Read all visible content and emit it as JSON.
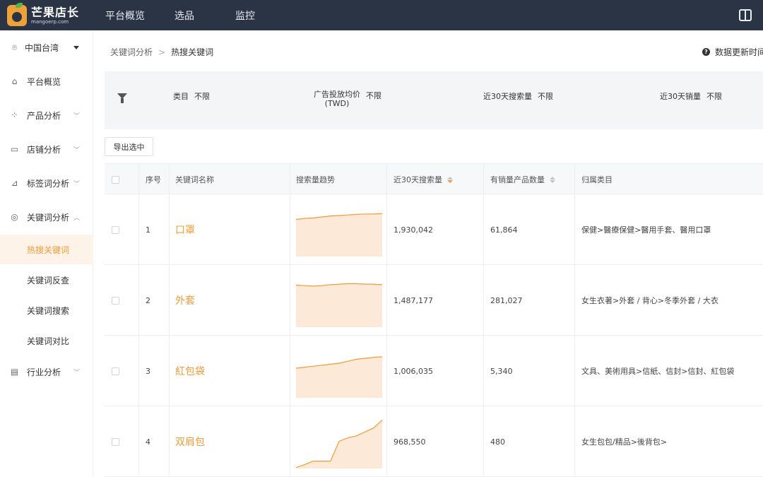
{
  "logo": {
    "title": "芒果店长",
    "subtitle": "mangoerp.com"
  },
  "topnav": [
    "平台概览",
    "选品",
    "监控"
  ],
  "icons": {
    "book": "book-icon",
    "location": "location-pin-icon",
    "filter": "filter-funnel-icon",
    "help": "question-circle-icon"
  },
  "colors": {
    "topbar": "#2b3445",
    "accent": "#f29b38",
    "spark_fill": "#fde9d7"
  },
  "sidebar": {
    "region": "中国台湾",
    "items": [
      {
        "label": "平台概览",
        "icon": "home-icon"
      },
      {
        "label": "产品分析",
        "icon": "grid-icon"
      },
      {
        "label": "店铺分析",
        "icon": "store-icon"
      },
      {
        "label": "标签词分析",
        "icon": "chart-icon"
      },
      {
        "label": "关键词分析",
        "icon": "target-icon"
      },
      {
        "label": "行业分析",
        "icon": "report-icon"
      }
    ],
    "sub_items": [
      "热搜关键词",
      "关键词反查",
      "关键词搜索",
      "关键词对比"
    ]
  },
  "breadcrumb": {
    "parent": "关键词分析",
    "separator": ">",
    "current": "热搜关键词"
  },
  "update_text": "数据更新时间",
  "filters": [
    {
      "name": "类目",
      "value": "不限"
    },
    {
      "name": "广告投放均价",
      "unit": "(TWD)",
      "value": "不限"
    },
    {
      "name": "近30天搜索量",
      "value": "不限"
    },
    {
      "name": "近30天销量",
      "value": "不限"
    }
  ],
  "export_label": "导出选中",
  "table": {
    "headers": [
      "序号",
      "关键词名称",
      "搜索量趋势",
      "近30天搜索量",
      "有销量产品数量",
      "归属类目"
    ],
    "rows": [
      {
        "index": "1",
        "keyword": "口罩",
        "searches": "1,930,042",
        "products": "61,864",
        "category": "保健>醫療保健>醫用手套、醫用口罩",
        "trend": [
          0.75,
          0.77,
          0.78,
          0.8,
          0.82,
          0.83,
          0.84,
          0.85,
          0.86,
          0.86,
          0.87
        ]
      },
      {
        "index": "2",
        "keyword": "外套",
        "searches": "1,487,177",
        "products": "281,027",
        "category": "女生衣著>外套 / 背心>冬季外套 / 大衣",
        "trend": [
          0.85,
          0.84,
          0.83,
          0.84,
          0.86,
          0.87,
          0.88,
          0.88,
          0.87,
          0.87,
          0.86
        ]
      },
      {
        "index": "3",
        "keyword": "紅包袋",
        "searches": "1,006,035",
        "products": "5,340",
        "category": "文具、美術用具>信紙、信封>信封、紅包袋",
        "trend": [
          0.6,
          0.62,
          0.64,
          0.66,
          0.68,
          0.7,
          0.74,
          0.78,
          0.8,
          0.82,
          0.83
        ]
      },
      {
        "index": "4",
        "keyword": "双肩包",
        "searches": "968,550",
        "products": "480",
        "category": "女生包包/精品>後背包>",
        "trend": [
          0.02,
          0.08,
          0.15,
          0.15,
          0.15,
          0.55,
          0.62,
          0.66,
          0.74,
          0.82,
          0.98
        ]
      }
    ]
  }
}
